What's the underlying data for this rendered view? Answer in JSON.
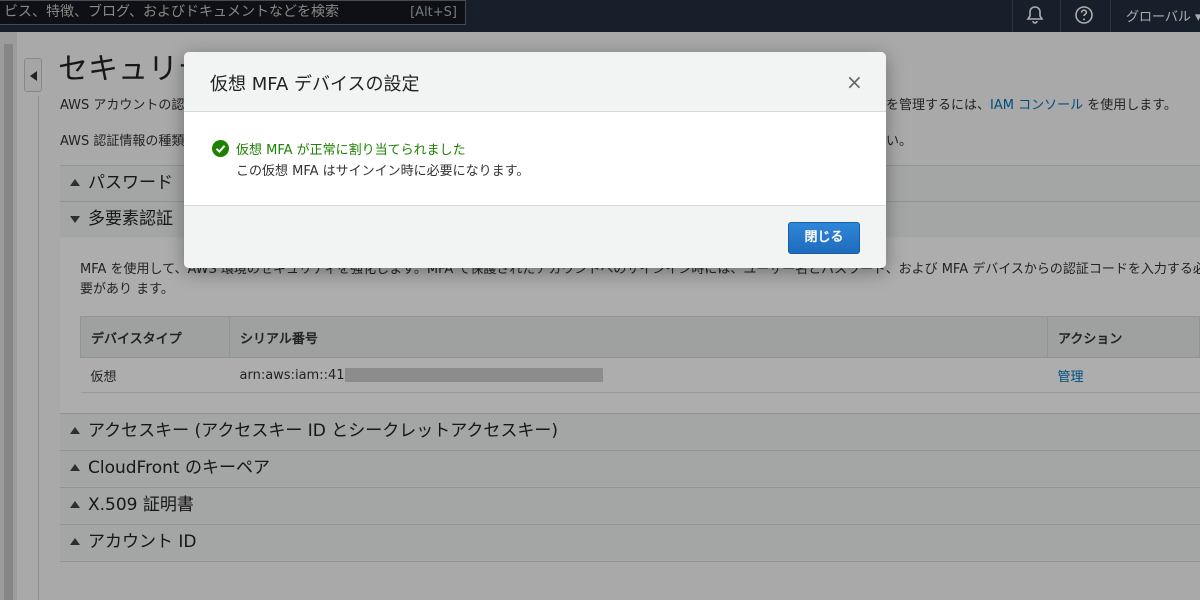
{
  "topbar": {
    "search_placeholder": "ビス、特徴、ブログ、およびドキュメントなどを検索",
    "search_shortcut": "[Alt+S]",
    "region_label": "グローバル ▾"
  },
  "page": {
    "title": "セキュリテ",
    "intro_left": "AWS アカウントの認",
    "intro_right_prefix": "を管理するには、",
    "intro_right_link": "IAM コンソール",
    "intro_right_suffix": " を使用します。",
    "intro2_left": "AWS 認証情報の種類",
    "intro2_right": "い。"
  },
  "sections": {
    "password": "パスワード",
    "mfa": "多要素認証",
    "access_keys": "アクセスキー (アクセスキー ID とシークレットアクセスキー)",
    "cloudfront": "CloudFront のキーペア",
    "x509": "X.509 証明書",
    "account_id": "アカウント ID"
  },
  "mfa": {
    "description": "MFA を使用して、AWS 環境のセキュリティを強化します。MFA で保護されたアカウントへのサインイン時には、ユーザー名とパスワード、および MFA デバイスからの認証コードを入力する必要があり ます。",
    "table": {
      "headers": [
        "デバイスタイプ",
        "シリアル番号",
        "アクション"
      ],
      "row": {
        "device_type": "仮想",
        "serial": "arn:aws:iam::41",
        "action": "管理"
      }
    }
  },
  "modal": {
    "title": "仮想 MFA デバイスの設定",
    "close_symbol": "×",
    "success_title": "仮想 MFA が正常に割り当てられました",
    "success_detail": "この仮想 MFA はサインイン時に必要になります。",
    "close_button": "閉じる"
  },
  "colors": {
    "topbar": "#232f3e",
    "success": "#1d8102",
    "primary_button": "#1f6bbd",
    "link": "#0073bb"
  }
}
